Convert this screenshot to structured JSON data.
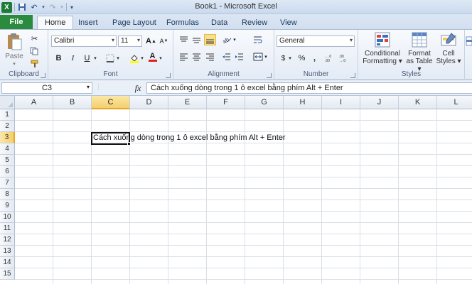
{
  "window": {
    "title": "Book1 - Microsoft Excel",
    "app_icon": "excel-logo-icon"
  },
  "ribbon_tabs": {
    "file": "File",
    "tabs": [
      "Home",
      "Insert",
      "Page Layout",
      "Formulas",
      "Data",
      "Review",
      "View"
    ],
    "active": "Home"
  },
  "clipboard": {
    "paste": "Paste",
    "label": "Clipboard"
  },
  "font": {
    "name": "Calibri",
    "size": "11",
    "bold": "B",
    "italic": "I",
    "underline": "U",
    "grow": "A",
    "shrink": "A",
    "color_letter": "A",
    "label": "Font"
  },
  "alignment": {
    "label": "Alignment"
  },
  "number": {
    "format": "General",
    "currency": "$",
    "percent": "%",
    "comma": ",",
    "label": "Number"
  },
  "styles": {
    "conditional_line1": "Conditional",
    "conditional_line2": "Formatting ▾",
    "format_table_line1": "Format",
    "format_table_line2": "as Table ▾",
    "cell_styles_line1": "Cell",
    "cell_styles_line2": "Styles ▾",
    "label": "Styles"
  },
  "formula_bar": {
    "name_box": "C3",
    "fx": "fx",
    "formula": "Cách xuống dòng trong 1 ô excel bằng phím Alt + Enter"
  },
  "grid": {
    "columns": [
      "A",
      "B",
      "C",
      "D",
      "E",
      "F",
      "G",
      "H",
      "I",
      "J",
      "K",
      "L"
    ],
    "rows": [
      "1",
      "2",
      "3",
      "4",
      "5",
      "6",
      "7",
      "8",
      "9",
      "10",
      "11",
      "12",
      "13",
      "14",
      "15"
    ],
    "selected_column": "C",
    "selected_row": "3",
    "c3_value": "Cách xuống dòng trong 1 ô excel bằng phím Alt + Enter"
  }
}
